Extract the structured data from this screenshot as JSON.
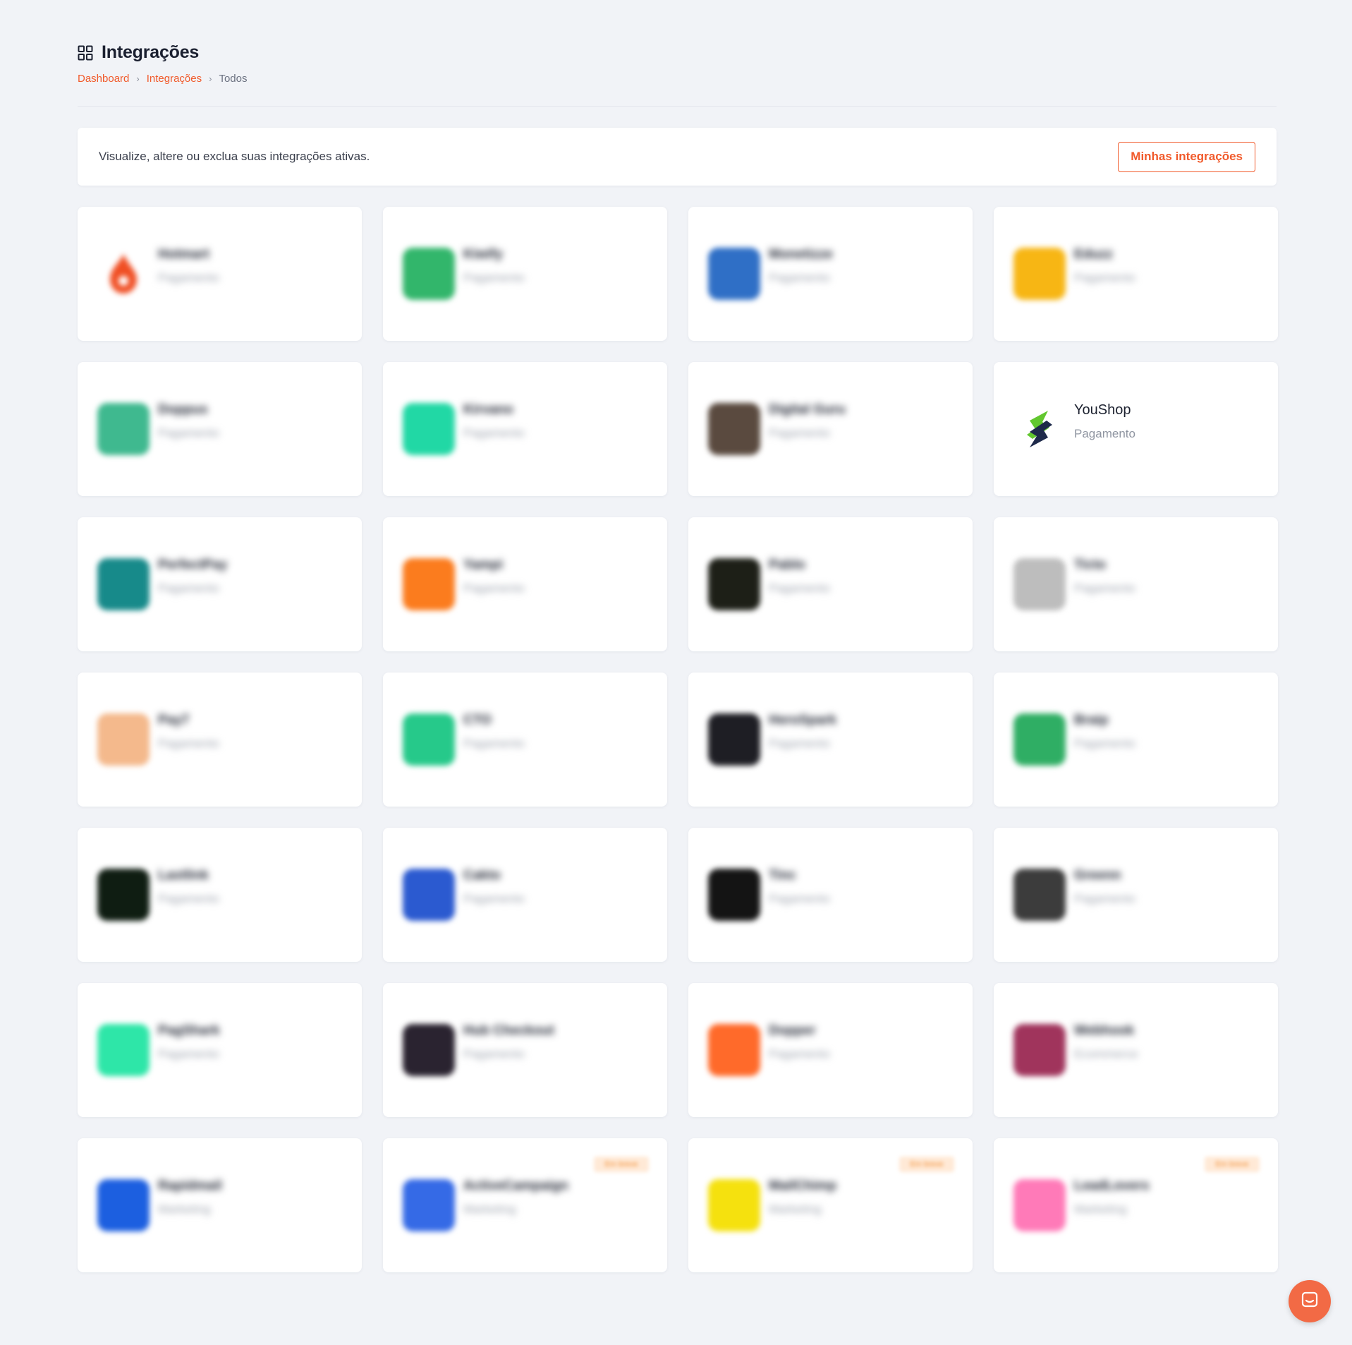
{
  "header": {
    "title": "Integrações"
  },
  "breadcrumb": [
    {
      "label": "Dashboard"
    },
    {
      "label": "Integrações"
    },
    {
      "label": "Todos"
    }
  ],
  "info_bar": {
    "text": "Visualize, altere ou exclua suas integrações ativas.",
    "button_label": "Minhas integrações"
  },
  "cards": [
    {
      "name": "Hotmart",
      "category": "Pagamento",
      "icon": "hotmart-flame-icon",
      "color": "#f04e23"
    },
    {
      "name": "Kiwify",
      "category": "Pagamento",
      "icon": "kiwify-logo-icon",
      "color": "#32b66b"
    },
    {
      "name": "Monetizze",
      "category": "Pagamento",
      "icon": "monetizze-logo-icon",
      "color": "#2f6fc6"
    },
    {
      "name": "Eduzz",
      "category": "Pagamento",
      "icon": "eduzz-logo-icon",
      "color": "#f7b614"
    },
    {
      "name": "Doppus",
      "category": "Pagamento",
      "icon": "doppus-logo-icon",
      "color": "#3fb98f"
    },
    {
      "name": "Kirvano",
      "category": "Pagamento",
      "icon": "kirvano-logo-icon",
      "color": "#21d8a5"
    },
    {
      "name": "Digital Guru",
      "category": "Pagamento",
      "icon": "digital-guru-logo-icon",
      "color": "#5a4a3f"
    },
    {
      "name": "YouShop",
      "category": "Pagamento",
      "icon": "youshop-logo-icon",
      "color": "#62c72f"
    },
    {
      "name": "PerfectPay",
      "category": "Pagamento",
      "icon": "perfectpay-logo-icon",
      "color": "#178a8a"
    },
    {
      "name": "Yampi",
      "category": "Pagamento",
      "icon": "yampi-logo-icon",
      "color": "#fb7c1e"
    },
    {
      "name": "Pablo",
      "category": "Pagamento",
      "icon": "pablo-logo-icon",
      "color": "#1d1f17"
    },
    {
      "name": "Ticto",
      "category": "Pagamento",
      "icon": "ticto-logo-icon",
      "color": "#bdbdbd"
    },
    {
      "name": "Pay7",
      "category": "Pagamento",
      "icon": "pay7-logo-icon",
      "color": "#f4b98c"
    },
    {
      "name": "CTO",
      "category": "Pagamento",
      "icon": "cto-logo-icon",
      "color": "#26c98a"
    },
    {
      "name": "HeroSpark",
      "category": "Pagamento",
      "icon": "herospark-logo-icon",
      "color": "#1e1e24"
    },
    {
      "name": "Braip",
      "category": "Pagamento",
      "icon": "braip-logo-icon",
      "color": "#2fae64"
    },
    {
      "name": "Lastlink",
      "category": "Pagamento",
      "icon": "lastlink-logo-icon",
      "color": "#0f1d12"
    },
    {
      "name": "Cakto",
      "category": "Pagamento",
      "icon": "cakto-logo-icon",
      "color": "#2b5ad0"
    },
    {
      "name": "Tinc",
      "category": "Pagamento",
      "icon": "tinc-logo-icon",
      "color": "#141414"
    },
    {
      "name": "Greenn",
      "category": "Pagamento",
      "icon": "greenn-logo-icon",
      "color": "#3c3c3c"
    },
    {
      "name": "PagShark",
      "category": "Pagamento",
      "icon": "pagshark-logo-icon",
      "color": "#2ee6a8"
    },
    {
      "name": "Hub Checkout",
      "category": "Pagamento",
      "icon": "hub-checkout-logo-icon",
      "color": "#2a2330"
    },
    {
      "name": "Dopper",
      "category": "Pagamento",
      "icon": "dopper-logo-icon",
      "color": "#ff6a2a"
    },
    {
      "name": "Webhook",
      "category": "Ecommerce",
      "icon": "webhook-logo-icon",
      "color": "#a0345c"
    },
    {
      "name": "Rapidmail",
      "category": "Marketing",
      "icon": "rapidmail-logo-icon",
      "color": "#1c5fe0",
      "badge": ""
    },
    {
      "name": "ActiveCampaign",
      "category": "Marketing",
      "icon": "activecampaign-logo-icon",
      "color": "#356ae6",
      "badge": "Em breve"
    },
    {
      "name": "MailChimp",
      "category": "Marketing",
      "icon": "mailchimp-logo-icon",
      "color": "#f5e10e",
      "badge": "Em breve"
    },
    {
      "name": "LeadLovers",
      "category": "Marketing",
      "icon": "leadlovers-logo-icon",
      "color": "#ff7ab8",
      "badge": "Em breve"
    }
  ],
  "chat": {
    "icon": "chat-bubble-icon",
    "color": "#f26a45"
  },
  "colors": {
    "accent": "#f15a2b",
    "background": "#f1f3f7"
  }
}
